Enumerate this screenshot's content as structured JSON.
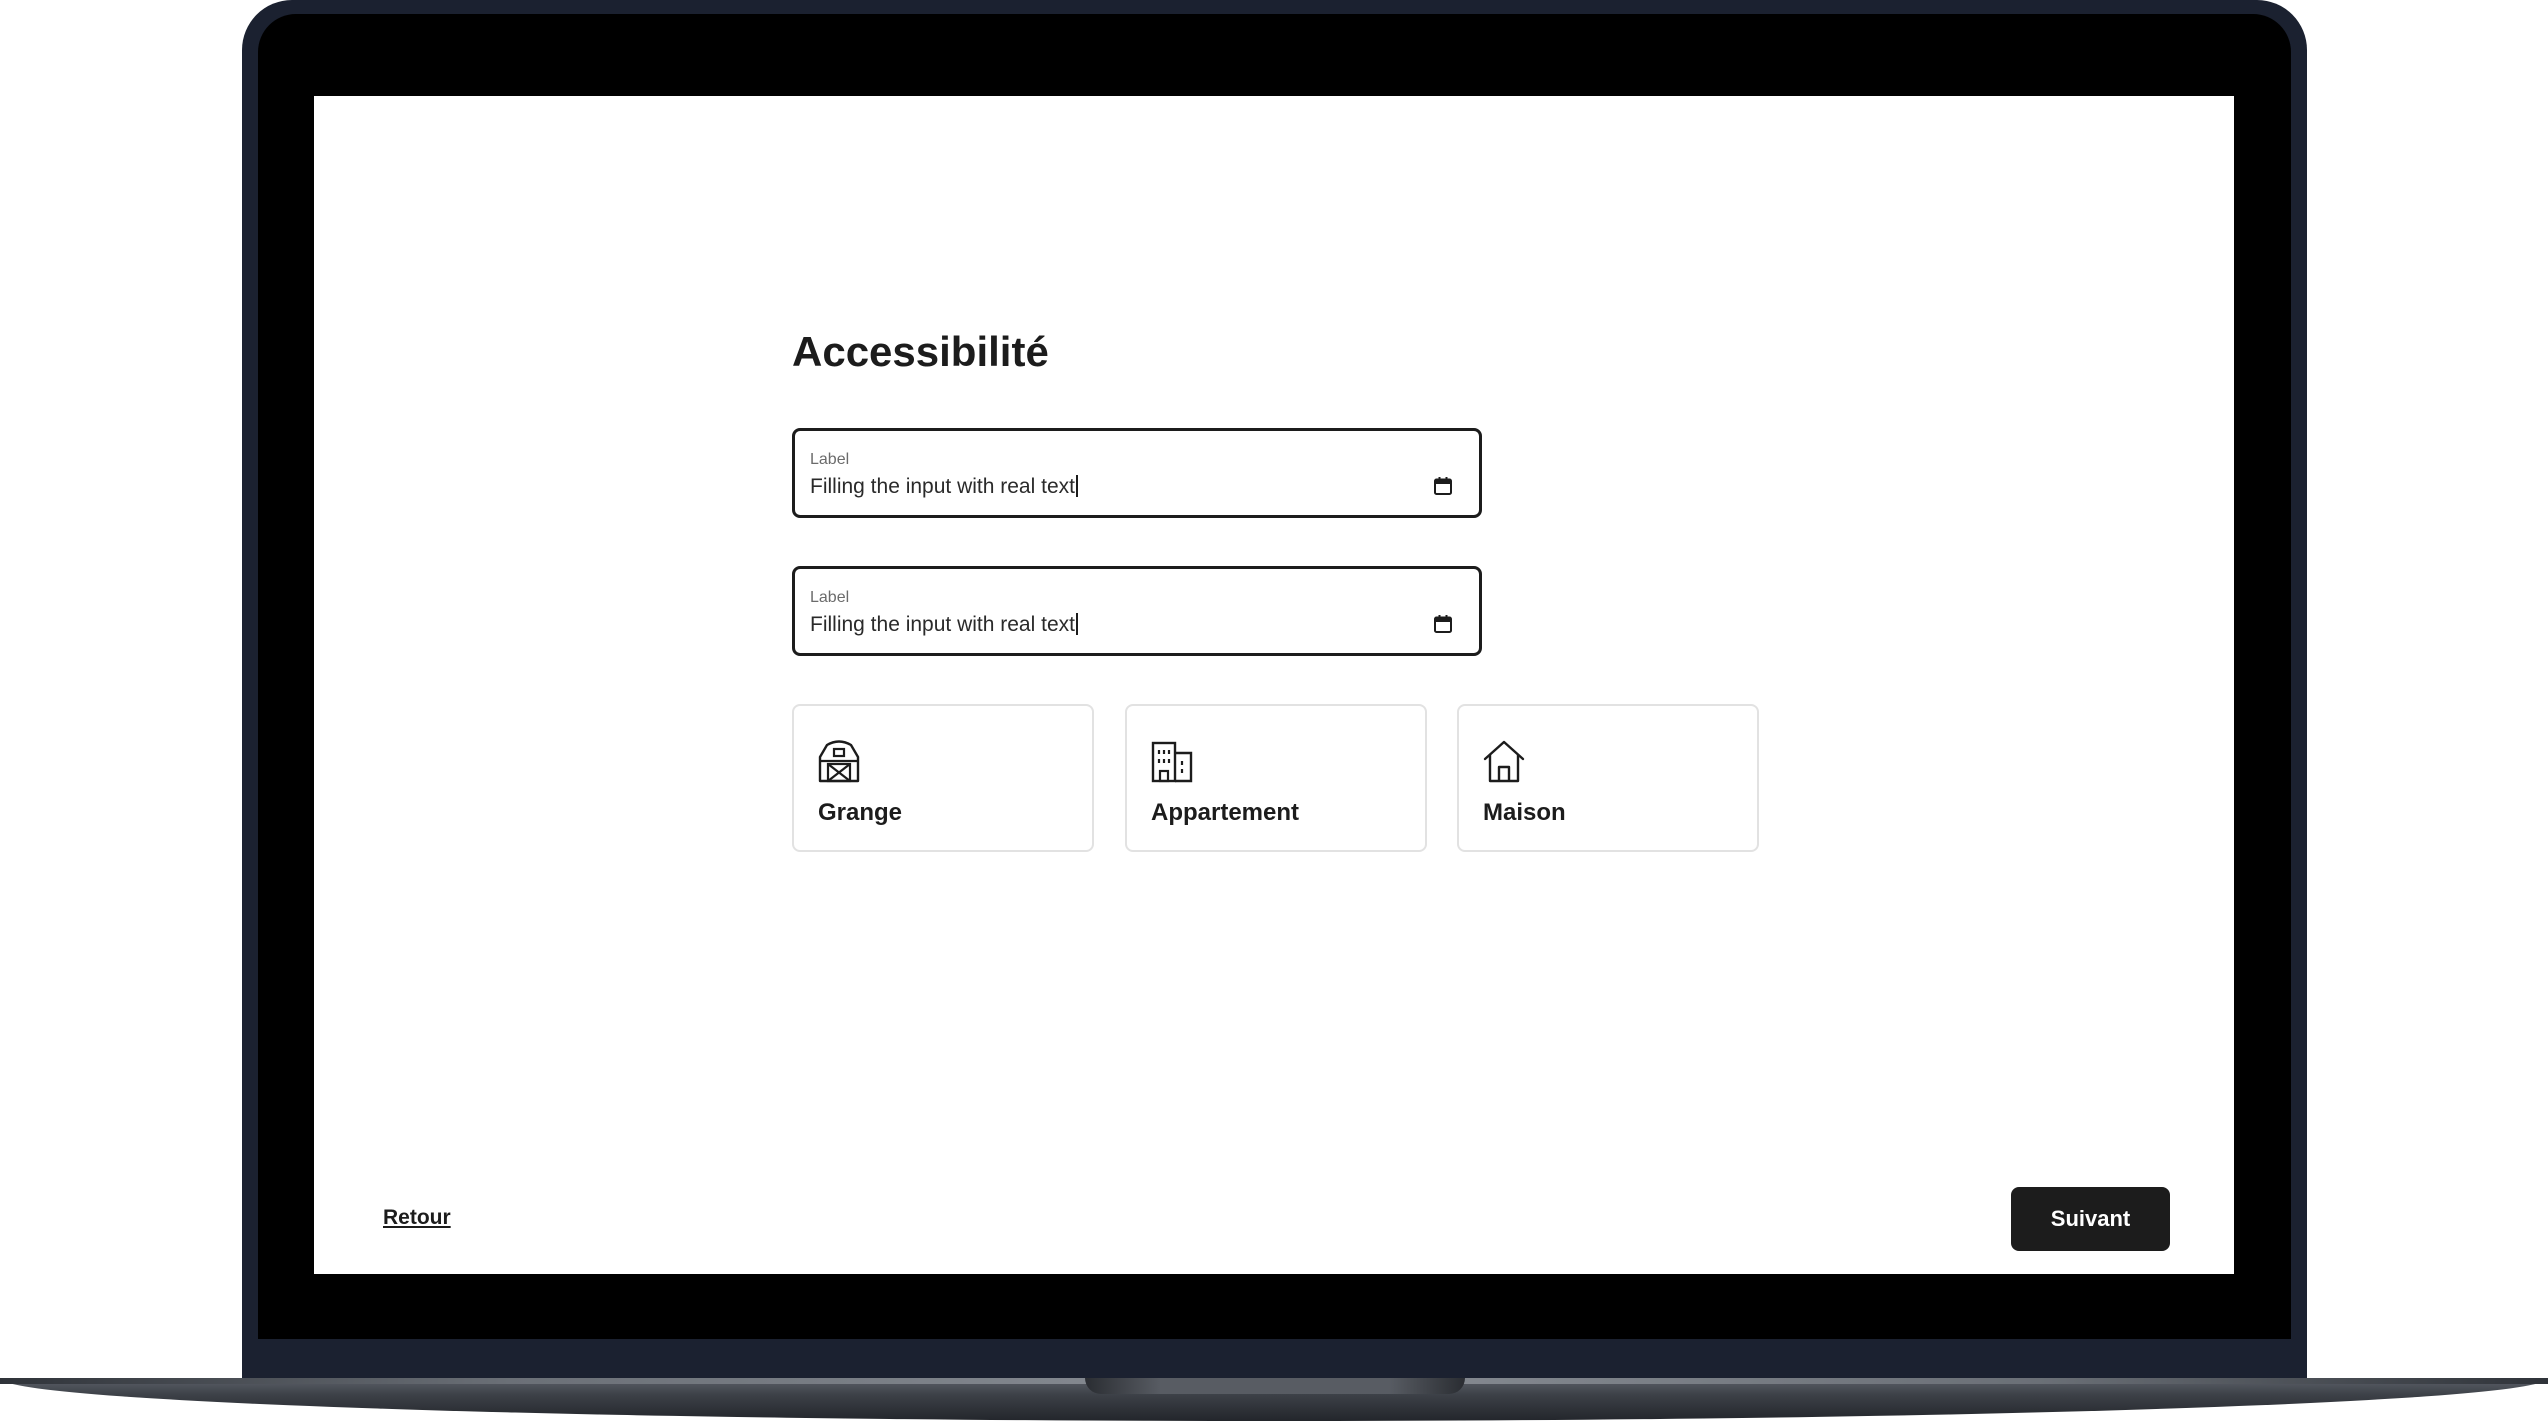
{
  "page": {
    "title": "Accessibilité"
  },
  "fields": [
    {
      "label": "Label",
      "value": "Filling the input with real text",
      "icon": "calendar-icon"
    },
    {
      "label": "Label",
      "value": "Filling the input with real text",
      "icon": "calendar-icon"
    }
  ],
  "options": [
    {
      "label": "Grange",
      "icon": "barn-icon"
    },
    {
      "label": "Appartement",
      "icon": "building-icon"
    },
    {
      "label": "Maison",
      "icon": "house-icon"
    }
  ],
  "footer": {
    "back_label": "Retour",
    "next_label": "Suivant"
  },
  "colors": {
    "frame": "#1b2130",
    "accent": "#1c1c1c",
    "card_border": "#e2e2e2"
  }
}
